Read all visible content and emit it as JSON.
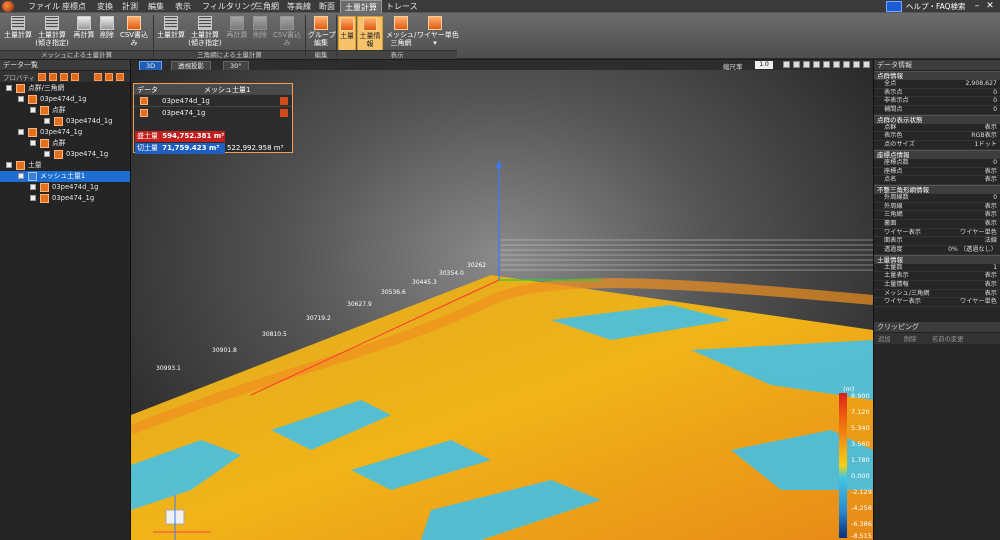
{
  "menu": {
    "items": [
      "ファイル",
      "座標点",
      "変換",
      "計測",
      "編集",
      "表示",
      "フィルタリング",
      "三角網",
      "等高線",
      "断面",
      "土量計算",
      "トレース"
    ],
    "active_index": 10,
    "help_label": "ヘルプ・FAQ検索"
  },
  "ribbon": {
    "buttons": [
      {
        "label": "土量計算",
        "icon": "grid-icon"
      },
      {
        "label": "土量計算\n(傾き指定)",
        "icon": "grid-icon"
      },
      {
        "label": "再計算",
        "icon": "calc-icon"
      },
      {
        "label": "削除",
        "icon": "delete-icon"
      },
      {
        "label": "CSV書込み",
        "icon": "csv-icon"
      },
      {
        "label": "土量計算",
        "icon": "grid-icon"
      },
      {
        "label": "土量計算\n(傾き指定)",
        "icon": "grid-icon"
      },
      {
        "label": "再計算",
        "icon": "calc-icon"
      },
      {
        "label": "削除",
        "icon": "delete-icon"
      },
      {
        "label": "CSV書込み",
        "icon": "csv-icon"
      },
      {
        "label": "グループ\n編集",
        "icon": "folder-icon"
      },
      {
        "label": "土量",
        "icon": "volume-icon"
      },
      {
        "label": "土量情報",
        "icon": "info-icon"
      },
      {
        "label": "メッシュ/\n三角網",
        "icon": "mesh-icon"
      },
      {
        "label": "ワイヤー単色\n▾",
        "icon": "wire-icon"
      }
    ],
    "groups": [
      "メッシュによる土量計算",
      "三角網による土量計算",
      "編集",
      "表示"
    ]
  },
  "left_panel": {
    "title": "データ一覧",
    "toolbar_label": "プロパティ",
    "tree": [
      {
        "label": "点群/三角網",
        "level": 0
      },
      {
        "label": "03pe474d_1g",
        "level": 1
      },
      {
        "label": "点群",
        "level": 2
      },
      {
        "label": "03pe474d_1g",
        "level": 3
      },
      {
        "label": "03pe474_1g",
        "level": 1
      },
      {
        "label": "点群",
        "level": 2
      },
      {
        "label": "03pe474_1g",
        "level": 3
      },
      {
        "label": "土量",
        "level": 0
      },
      {
        "label": "メッシュ土量1",
        "level": 1,
        "selected": true
      },
      {
        "label": "03pe474d_1g",
        "level": 2
      },
      {
        "label": "03pe474_1g",
        "level": 2
      }
    ]
  },
  "viewport": {
    "tabs": [
      "3D",
      "透視投影",
      "30°"
    ],
    "zoom_label": "縮尺率",
    "zoom_value": "1.0",
    "info": {
      "head_data": "データ",
      "head_name": "メッシュ土量1",
      "rows": [
        "03pe474d_1g",
        "03pe474_1g"
      ],
      "fill_label": "盛土量",
      "fill_value": "594,752.381 m³",
      "cut_label": "切土量",
      "cut_value": "71,759.423 m³",
      "net_value": "522,992.958 m³"
    },
    "axis_ticks": [
      "30262",
      "30354.0",
      "30445.3",
      "30536.6",
      "30627.9",
      "30719.2",
      "30810.5",
      "30901.8",
      "30993.1"
    ],
    "colorbar": {
      "unit": "(m)",
      "labels": [
        "8.900",
        "7.120",
        "5.340",
        "3.560",
        "1.780",
        "0.000",
        "-2.129",
        "-4.258",
        "-6.386",
        "-8.515"
      ]
    }
  },
  "right_panel": {
    "title": "データ情報",
    "sections": [
      {
        "title": "点群情報",
        "rows": [
          [
            "全点",
            "2,908,627"
          ],
          [
            "表示点",
            "0"
          ],
          [
            "非表示点",
            "0"
          ],
          [
            "補間点",
            "0"
          ]
        ]
      },
      {
        "title": "点群の表示状態",
        "rows": [
          [
            "点群",
            "表示"
          ],
          [
            "表示色",
            "RGB表示"
          ],
          [
            "点のサイズ",
            "1ドット"
          ]
        ]
      },
      {
        "title": "座標点情報",
        "rows": [
          [
            "座標点数",
            "0"
          ],
          [
            "座標点",
            "表示"
          ],
          [
            "点名",
            "表示"
          ]
        ]
      },
      {
        "title": "不整三角形網情報",
        "rows": [
          [
            "外周線数",
            "0"
          ],
          [
            "外周線",
            "表示"
          ],
          [
            "三角網",
            "表示"
          ],
          [
            "裏面",
            "表示"
          ],
          [
            "ワイヤー表示",
            "ワイヤー単色"
          ],
          [
            "面表示",
            "法線"
          ],
          [
            "透過度",
            "0% （透過なし）"
          ]
        ]
      },
      {
        "title": "土量情報",
        "rows": [
          [
            "土量数",
            "1"
          ],
          [
            "土量表示",
            "表示"
          ],
          [
            "土量情報",
            "表示"
          ],
          [
            "メッシュ/三角網",
            "表示"
          ],
          [
            "ワイヤー表示",
            "ワイヤー単色"
          ]
        ]
      }
    ],
    "clipping_title": "クリッピング",
    "clipping_tools": [
      "追加",
      "削除",
      "名前の変更"
    ]
  }
}
